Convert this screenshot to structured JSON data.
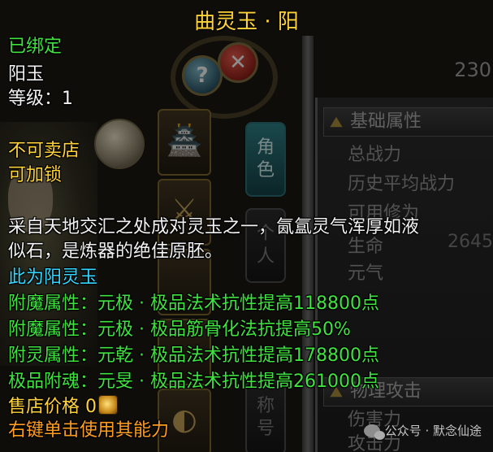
{
  "tooltip": {
    "title": "曲灵玉 · 阳",
    "bound": "已绑定",
    "item_type": "阳玉",
    "level": "等级：1",
    "not_sellable": "不可卖店",
    "lockable": "可加锁",
    "description_line1": "采自天地交汇之处成对灵玉之一，氤氲灵气浑厚如液",
    "description_line2": "似石，是炼器的绝佳原胚。",
    "yang_note": "此为阳灵玉",
    "attributes": [
      "附魔属性：元极 · 极品法术抗性提高118800点",
      "附魔属性：元极 · 极品筋骨化法抗提高50%",
      "附灵属性：元乾 · 极品法术抗性提高178800点",
      "极品附魂：元旻 · 极品法术抗性提高261000点"
    ],
    "sell_price": "售店价格 0",
    "right_click_hint": "右键单击使用其能力"
  },
  "background": {
    "top_number": "230",
    "tabs": [
      {
        "label": "角\n色"
      },
      {
        "label": "个\n人"
      },
      {
        "label": "称\n号"
      }
    ],
    "basic_section": "基础属性",
    "stats": [
      "总战力",
      "历史平均战力",
      "可用修为",
      "生命",
      "元气"
    ],
    "hp_value": "2645",
    "physical_section": "物理攻击",
    "physical_stats": [
      "伤害力",
      "攻击力"
    ]
  },
  "watermark": {
    "text": "公众号 · 默念仙途"
  }
}
